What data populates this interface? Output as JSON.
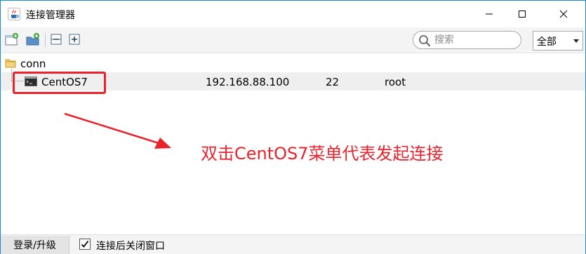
{
  "window": {
    "title": "连接管理器"
  },
  "toolbar": {
    "search": {
      "placeholder": "搜索",
      "value": ""
    },
    "scope": {
      "selected": "全部"
    }
  },
  "tree": {
    "folder": {
      "label": "conn"
    },
    "connections": [
      {
        "name": "CentOS7",
        "host": "192.168.88.100",
        "port": "22",
        "user": "root"
      }
    ]
  },
  "annotation": {
    "text": "双击CentOS7菜单代表发起连接",
    "color": "#e8232b"
  },
  "statusbar": {
    "login_label": "登录/升级",
    "close_after_connect": {
      "label": "连接后关闭窗口",
      "checked": true
    }
  },
  "icons": {
    "app": "java-cup-icon",
    "new_connection": "new-connection-icon",
    "new_folder": "new-folder-icon",
    "collapse_all": "collapse-all-icon",
    "expand_all": "expand-all-icon",
    "search": "search-icon",
    "folder": "folder-icon",
    "terminal": "terminal-icon"
  }
}
